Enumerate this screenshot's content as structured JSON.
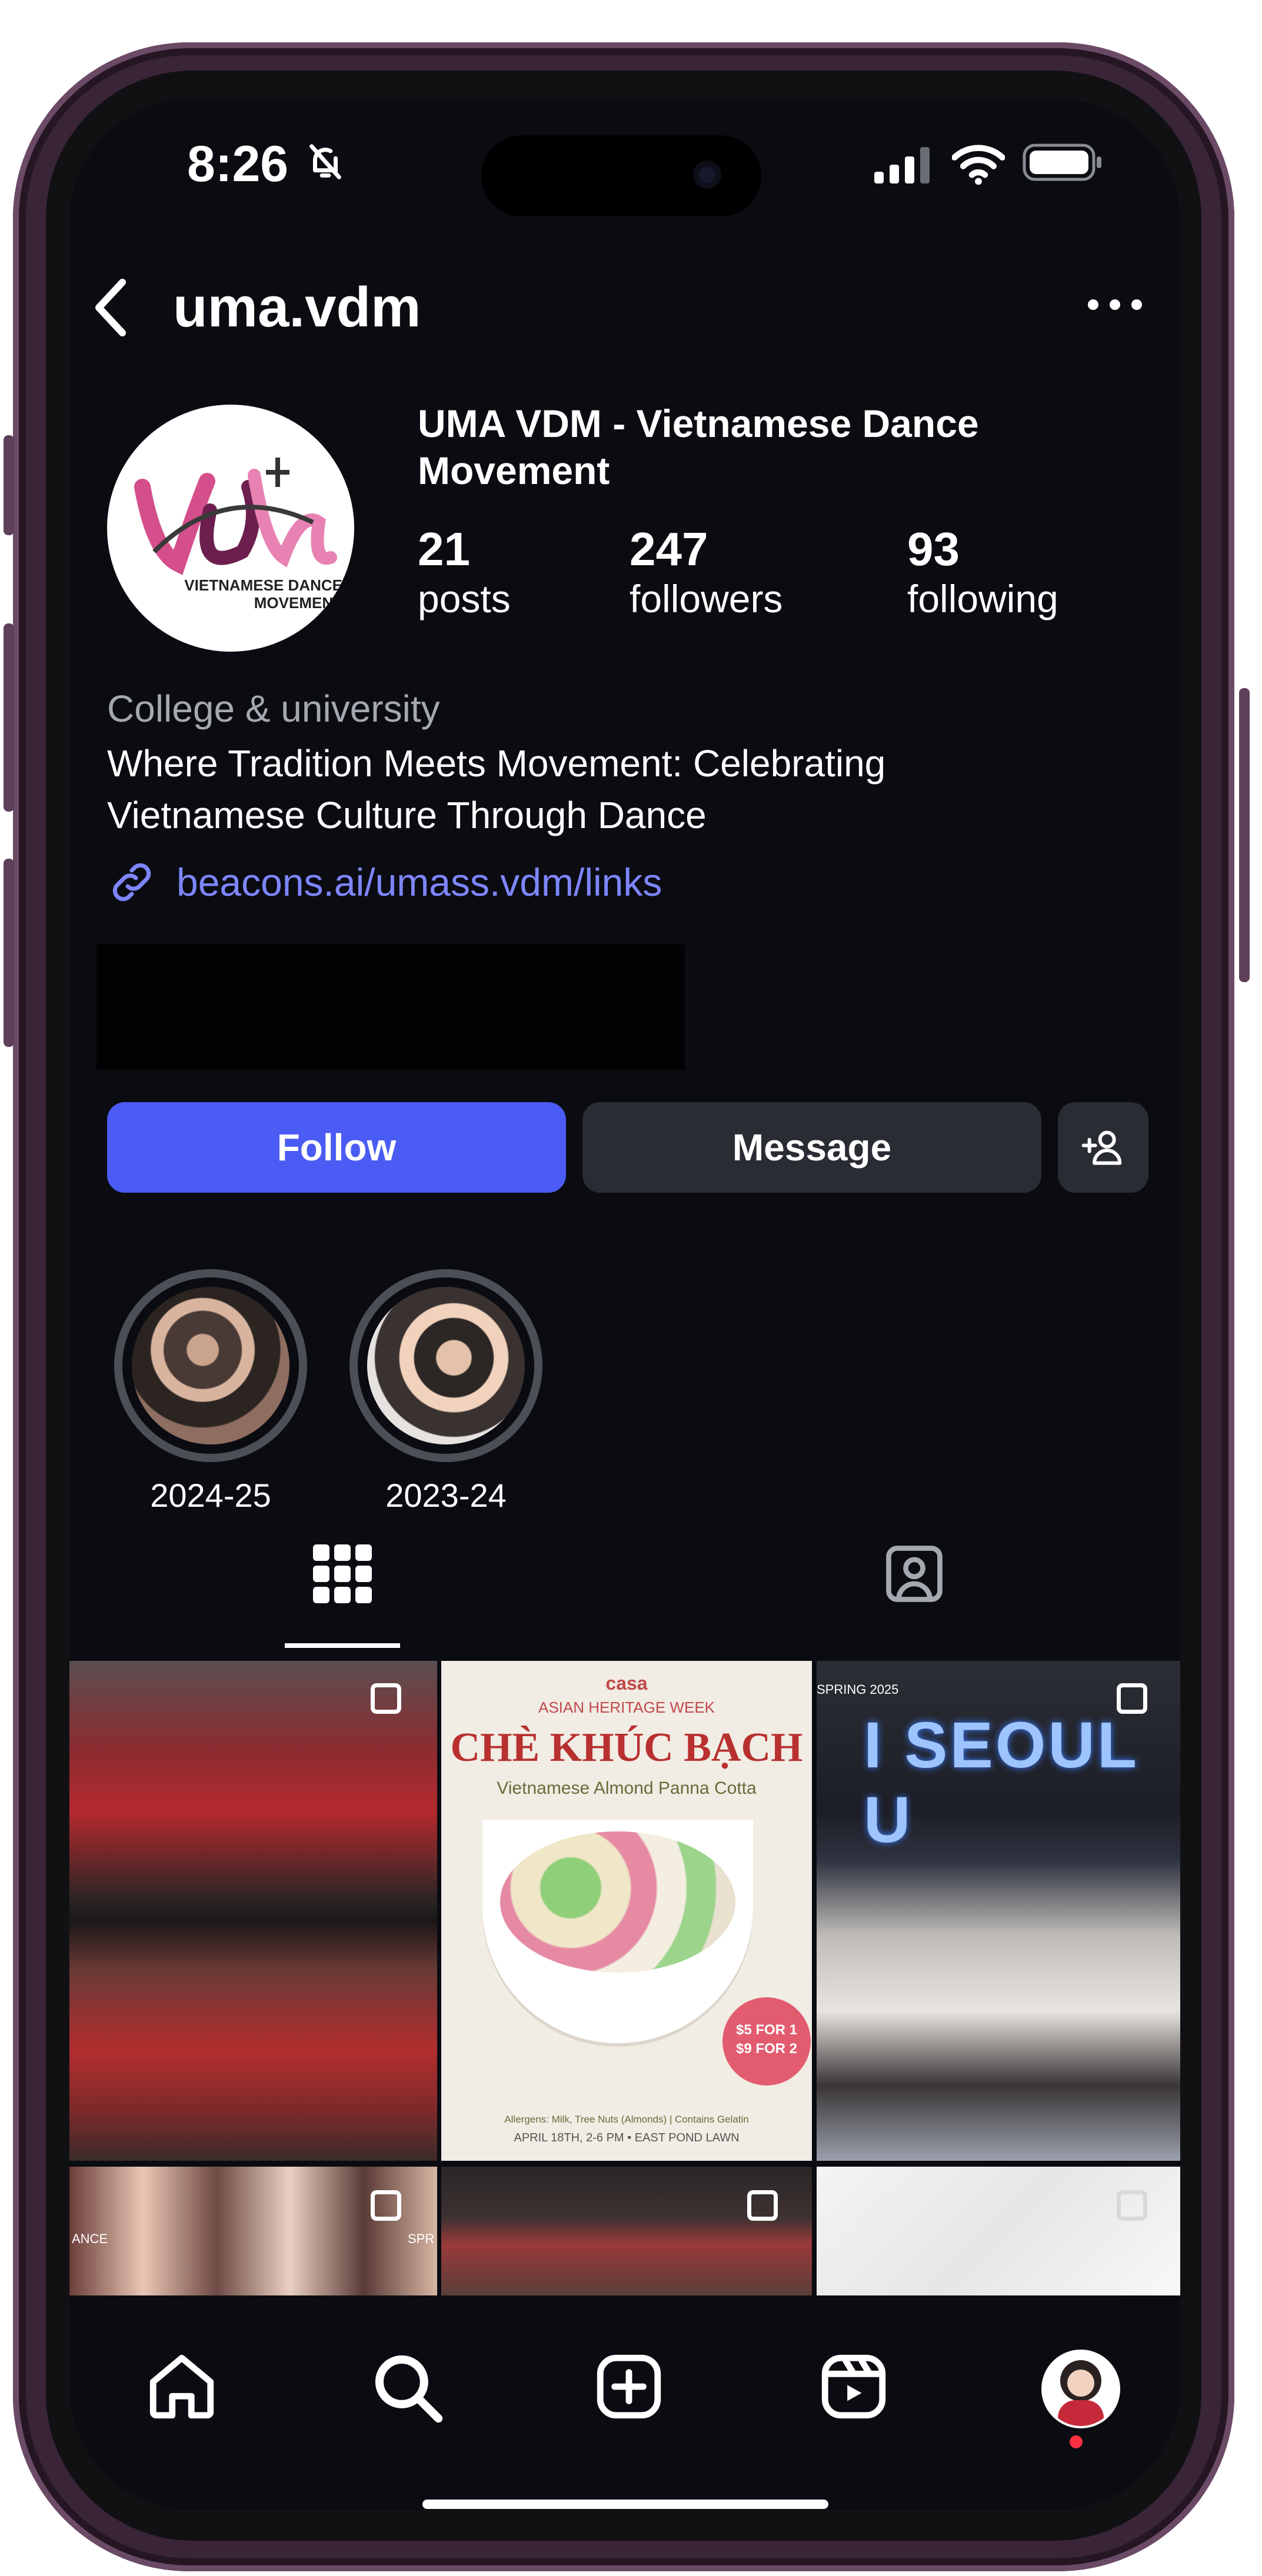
{
  "status_bar": {
    "time": "8:26"
  },
  "header": {
    "username": "uma.vdm"
  },
  "profile": {
    "display_name": "UMA VDM - Vietnamese Dance Movement",
    "avatar_logo_text": "VIETNAMESE DANCE MOVEMENT",
    "stats": [
      {
        "value": "21",
        "label": "posts"
      },
      {
        "value": "247",
        "label": "followers"
      },
      {
        "value": "93",
        "label": "following"
      }
    ],
    "category": "College & university",
    "bio_line1": "Where Tradition Meets Movement: Celebrating",
    "bio_line2": "Vietnamese Culture Through Dance",
    "link": "beacons.ai/umass.vdm/links"
  },
  "actions": {
    "follow": "Follow",
    "message": "Message"
  },
  "highlights": [
    {
      "label": "2024-25"
    },
    {
      "label": "2023-24"
    }
  ],
  "grid": {
    "post2": {
      "brand": "casa",
      "tag": "ASIAN HERITAGE WEEK",
      "title": "CHÈ KHÚC BẠCH",
      "subtitle": "Vietnamese Almond Panna Cotta",
      "price1": "$5 FOR 1",
      "price2": "$9 FOR 2",
      "allergens": "Allergens: Milk, Tree Nuts (Almonds) | Contains Gelatin",
      "when": "APRIL 18TH, 2-6 PM • EAST POND LAWN"
    },
    "post3": {
      "label": "SPRING 2025",
      "sign": "I SEOUL U"
    },
    "post4": {
      "left_text": "ANCE",
      "right_text": "SPR"
    }
  },
  "bottom_nav": [
    "home-icon",
    "search-icon",
    "create-icon",
    "reels-icon",
    "profile-avatar"
  ],
  "colors": {
    "accent": "#4a5cf3",
    "link": "#7e86ff",
    "background": "#0b0c12",
    "secondary_button": "#2a2c33"
  }
}
